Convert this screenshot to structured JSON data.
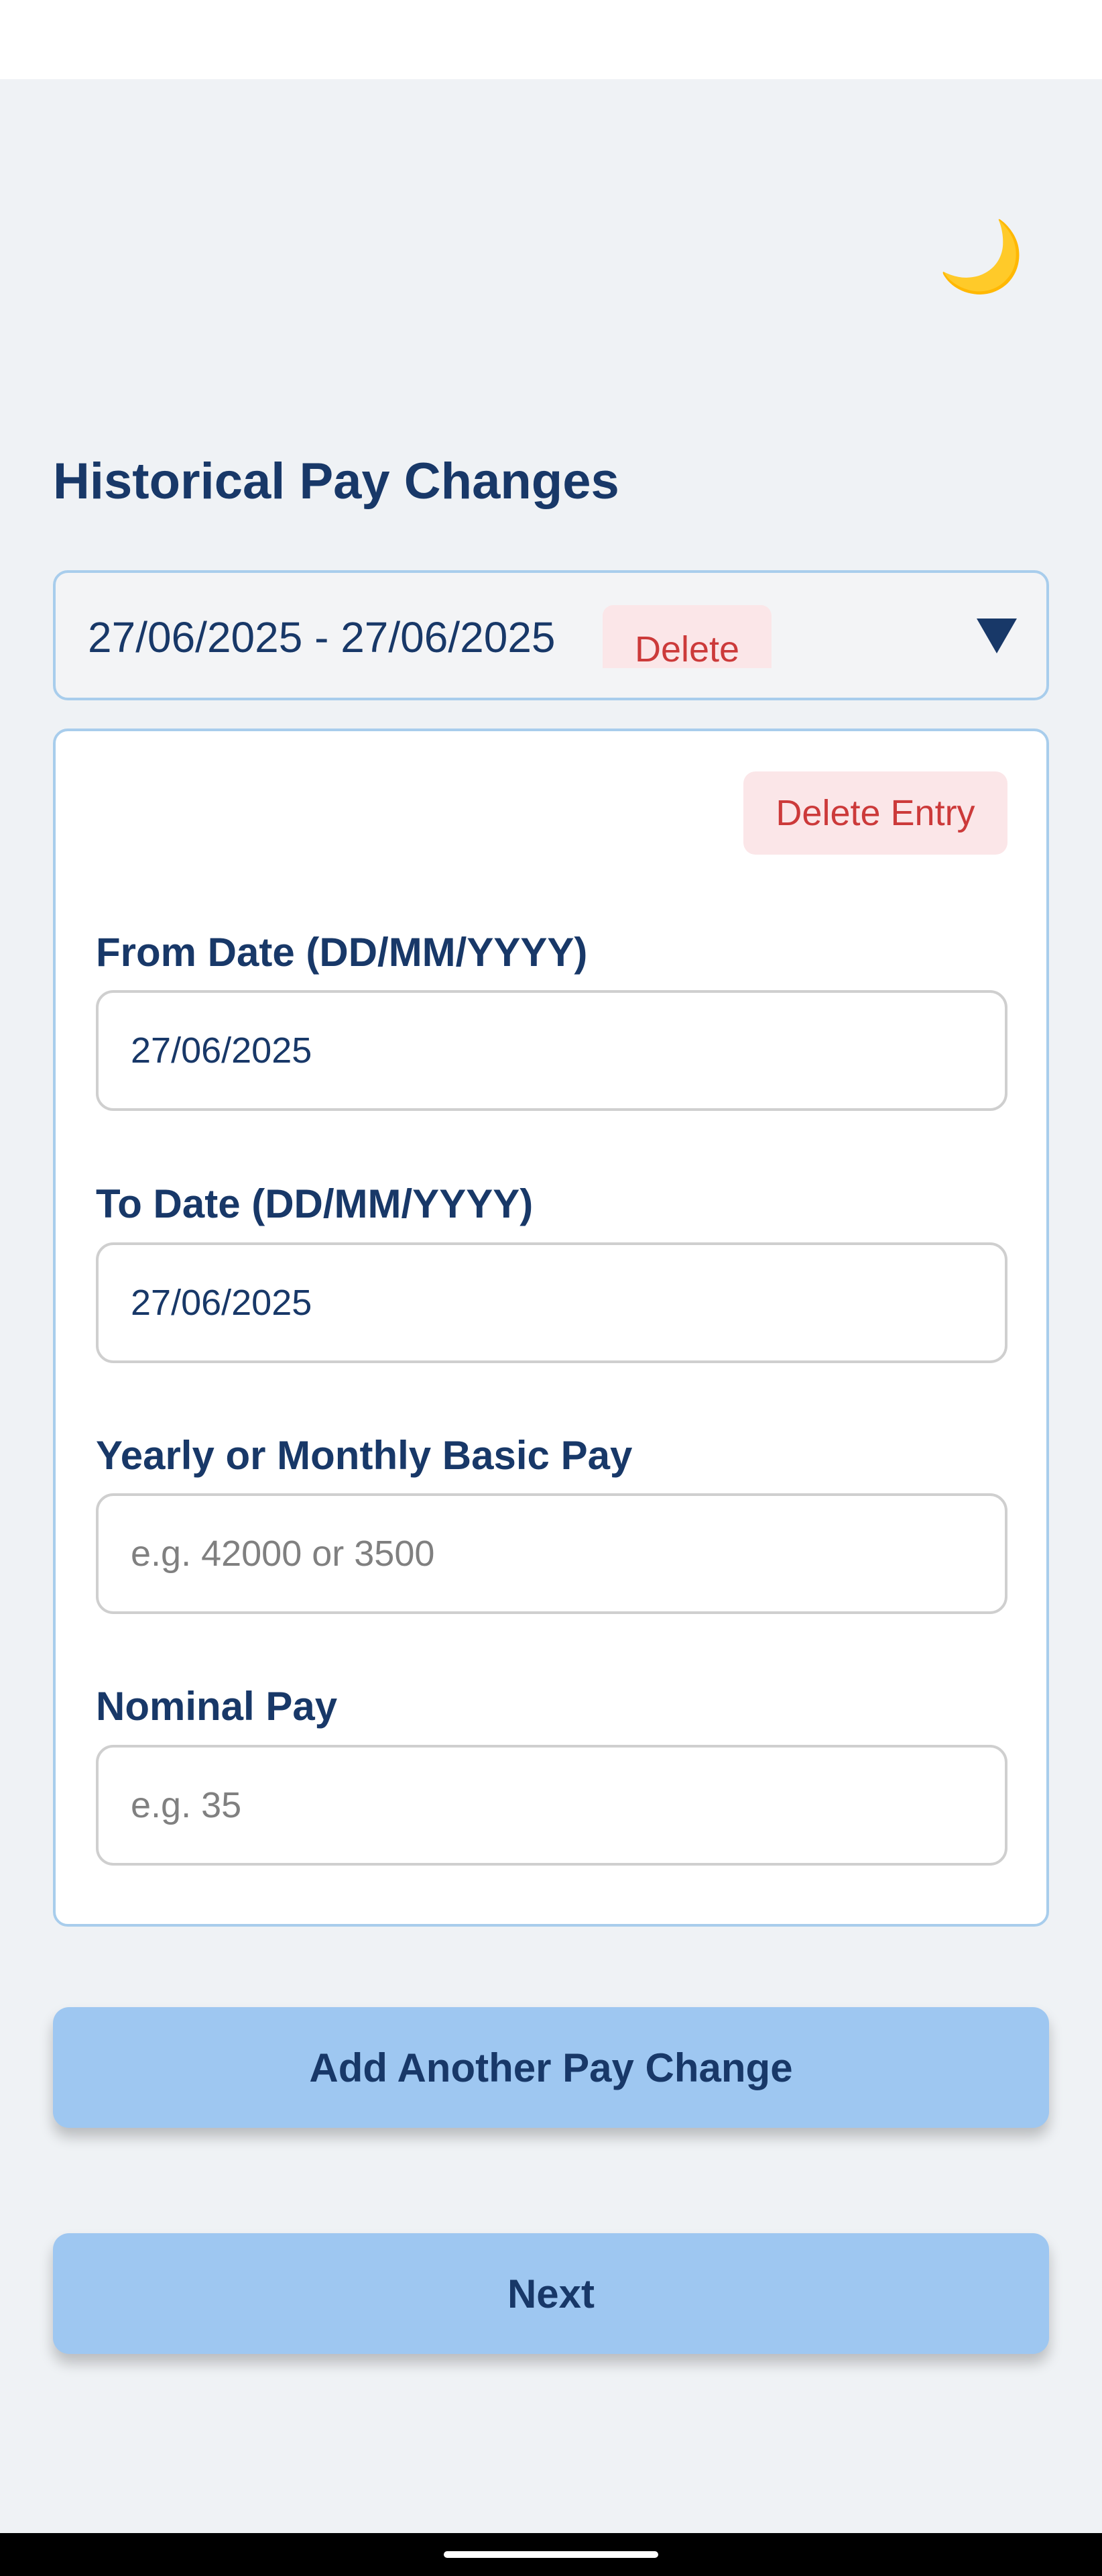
{
  "page": {
    "title": "Historical Pay Changes"
  },
  "theme_toggle": {
    "icon": "moon-icon",
    "glyph": "🌙"
  },
  "accordion": {
    "range_label": "27/06/2025 - 27/06/2025",
    "delete_label": "Delete",
    "expanded_icon": "chevron-down-icon"
  },
  "entry": {
    "delete_entry_label": "Delete Entry",
    "fields": [
      {
        "label": "From Date (DD/MM/YYYY)",
        "value": "27/06/2025",
        "placeholder": ""
      },
      {
        "label": "To Date (DD/MM/YYYY)",
        "value": "27/06/2025",
        "placeholder": ""
      },
      {
        "label": "Yearly or Monthly Basic Pay",
        "value": "",
        "placeholder": "e.g. 42000 or 3500"
      },
      {
        "label": "Nominal Pay",
        "value": "",
        "placeholder": "e.g. 35"
      }
    ]
  },
  "actions": {
    "add_label": "Add Another Pay Change",
    "next_label": "Next"
  },
  "colors": {
    "background": "#eff2f5",
    "heading": "#183868",
    "accent_button": "#9ec7f1",
    "card_border": "#a8cdec",
    "danger_text": "#cc3a3a",
    "danger_bg": "#fbe6e8"
  }
}
